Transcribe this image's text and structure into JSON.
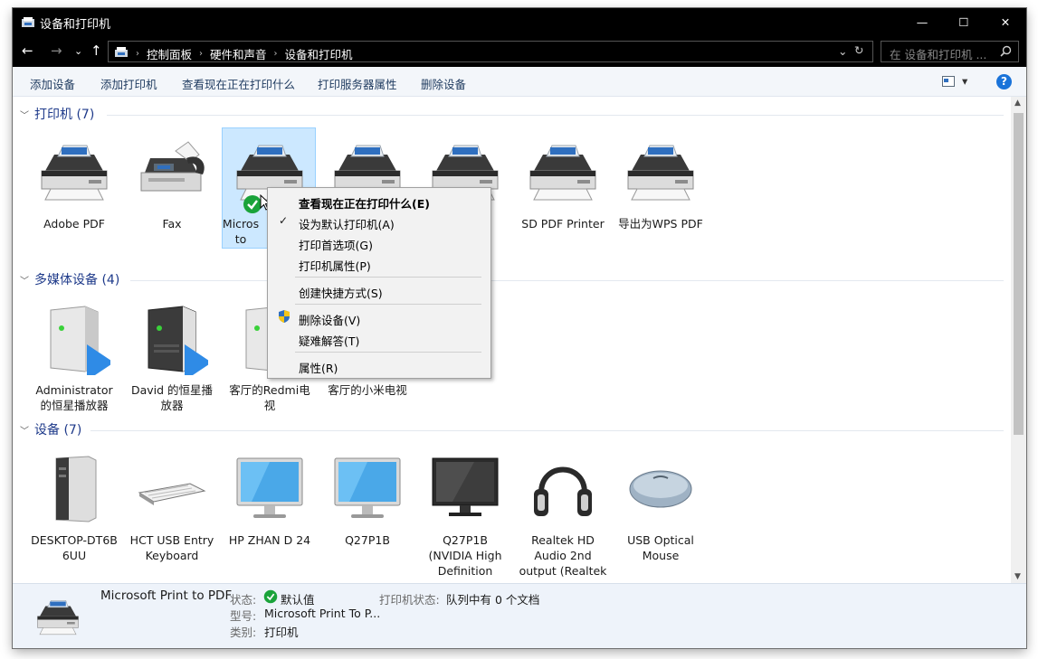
{
  "window": {
    "title": "设备和打印机",
    "minimize_glyph": "—",
    "maximize_glyph": "☐",
    "close_glyph": "✕"
  },
  "nav": {
    "back": "←",
    "forward": "→",
    "history": "⌄",
    "up": "↑"
  },
  "address": {
    "crumbs": [
      "控制面板",
      "硬件和声音",
      "设备和打印机"
    ],
    "separator": "›",
    "dropdown": "⌄",
    "refresh": "↻"
  },
  "search": {
    "placeholder": "在 设备和打印机 ...",
    "icon": "search-icon"
  },
  "commands": [
    "添加设备",
    "添加打印机",
    "查看现在正在打印什么",
    "打印服务器属性",
    "删除设备"
  ],
  "view_toggle": "▾",
  "help": "?",
  "groups": {
    "printers": {
      "title": "打印机 (7)",
      "items": [
        "Adobe PDF",
        "Fax",
        "Micros",
        "to",
        "SD PDF Printer",
        "导出为WPS PDF"
      ]
    },
    "media": {
      "title": "多媒体设备 (4)",
      "items": [
        [
          "Administrator",
          "的恒星播放器"
        ],
        [
          "David 的恒星播",
          "放器"
        ],
        [
          "客厅的Redmi电",
          "视"
        ],
        [
          "客厅的小米电视"
        ]
      ]
    },
    "devices": {
      "title": "设备 (7)",
      "items": [
        [
          "DESKTOP-DT6B",
          "6UU"
        ],
        [
          "HCT USB Entry",
          "Keyboard"
        ],
        [
          "HP ZHAN D 24"
        ],
        [
          "Q27P1B"
        ],
        [
          "Q27P1B",
          "(NVIDIA High",
          "Definition"
        ],
        [
          "Realtek HD",
          "Audio 2nd",
          "output (Realtek"
        ],
        [
          "USB Optical",
          "Mouse"
        ]
      ]
    }
  },
  "context_menu": {
    "items": [
      "查看现在正在打印什么(E)",
      "设为默认打印机(A)",
      "打印首选项(G)",
      "打印机属性(P)",
      "创建快捷方式(S)",
      "删除设备(V)",
      "疑难解答(T)",
      "属性(R)"
    ],
    "check_glyph": "✓"
  },
  "details": {
    "name": "Microsoft Print to PDF",
    "status_label": "状态:",
    "status_value": "默认值",
    "printer_status_label": "打印机状态:",
    "printer_status_value": "队列中有 0 个文档",
    "model_label": "型号:",
    "model_value": "Microsoft Print To P...",
    "category_label": "类别:",
    "category_value": "打印机"
  },
  "colors": {
    "titlebar": "#000000",
    "selection": "#cce8ff",
    "group_header": "#1e3a8a",
    "details_bg": "#eef3fa"
  }
}
